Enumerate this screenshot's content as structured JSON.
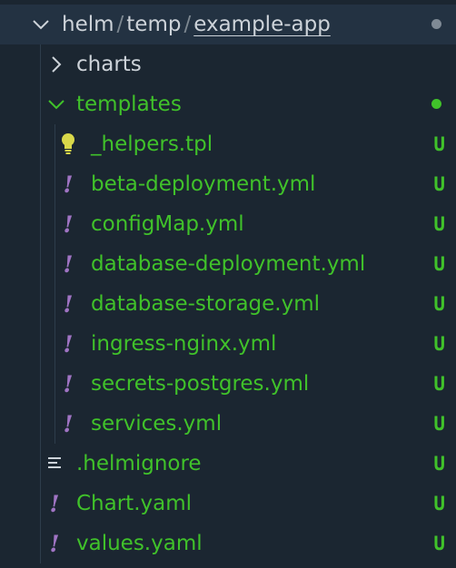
{
  "root": {
    "segments": [
      "helm",
      "temp",
      "example-app"
    ],
    "separator": "/",
    "dot_color": "#7f8a95"
  },
  "tree": {
    "charts": {
      "label": "charts"
    },
    "templates": {
      "label": "templates",
      "dot_color": "#40c22a"
    },
    "template_files": [
      {
        "name": "_helpers.tpl",
        "icon": "lightbulb-icon",
        "status": "U"
      },
      {
        "name": "beta-deployment.yml",
        "icon": "yaml-exclamation-icon",
        "status": "U"
      },
      {
        "name": "configMap.yml",
        "icon": "yaml-exclamation-icon",
        "status": "U"
      },
      {
        "name": "database-deployment.yml",
        "icon": "yaml-exclamation-icon",
        "status": "U"
      },
      {
        "name": "database-storage.yml",
        "icon": "yaml-exclamation-icon",
        "status": "U"
      },
      {
        "name": "ingress-nginx.yml",
        "icon": "yaml-exclamation-icon",
        "status": "U"
      },
      {
        "name": "secrets-postgres.yml",
        "icon": "yaml-exclamation-icon",
        "status": "U"
      },
      {
        "name": "services.yml",
        "icon": "yaml-exclamation-icon",
        "status": "U"
      }
    ],
    "root_files": [
      {
        "name": ".helmignore",
        "icon": "lines-icon",
        "status": "U"
      },
      {
        "name": "Chart.yaml",
        "icon": "yaml-exclamation-icon",
        "status": "U"
      },
      {
        "name": "values.yaml",
        "icon": "yaml-exclamation-icon",
        "status": "U"
      }
    ]
  },
  "colors": {
    "background": "#1b2631",
    "untracked_green": "#40c22a",
    "yaml_purple": "#a074c4",
    "lightbulb_yellow": "#d9d84a"
  }
}
